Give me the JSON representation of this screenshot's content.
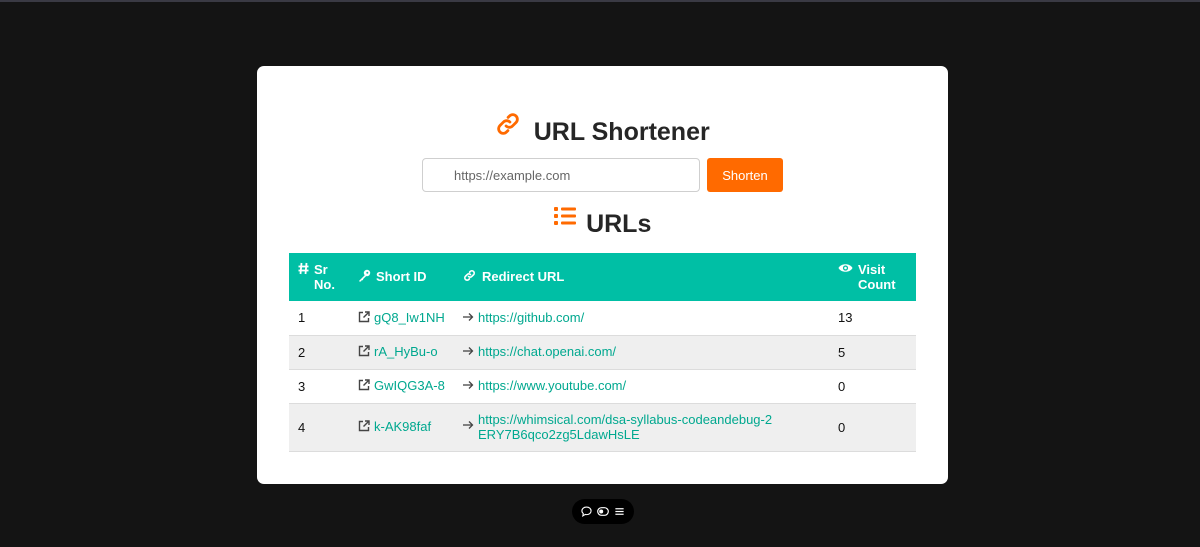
{
  "header": {
    "title": "URL Shortener",
    "title_icon": "link-icon",
    "accent_color": "#ff6a00"
  },
  "form": {
    "url_placeholder": "https://example.com",
    "url_value": "",
    "submit_label": "Shorten"
  },
  "list": {
    "title": "URLs",
    "title_icon": "list-icon",
    "header_color": "#00bfa5",
    "columns": [
      {
        "label": "Sr No.",
        "icon": "hash-icon"
      },
      {
        "label": "Short ID",
        "icon": "key-icon"
      },
      {
        "label": "Redirect URL",
        "icon": "link-icon"
      },
      {
        "label": "Visit Count",
        "icon": "eye-icon"
      }
    ],
    "rows": [
      {
        "sr": "1",
        "short_id": "gQ8_Iw1NH",
        "redirect_url": "https://github.com/",
        "visits": "13"
      },
      {
        "sr": "2",
        "short_id": "rA_HyBu-o",
        "redirect_url": "https://chat.openai.com/",
        "visits": "5"
      },
      {
        "sr": "3",
        "short_id": "GwIQG3A-8",
        "redirect_url": "https://www.youtube.com/",
        "visits": "0"
      },
      {
        "sr": "4",
        "short_id": "k-AK98faf",
        "redirect_url": "https://whimsical.com/dsa-syllabus-codeandebug-2ERY7B6qco2zg5LdawHsLE",
        "visits": "0"
      }
    ]
  },
  "dock": {
    "icons": [
      "chat-icon",
      "toggle-icon",
      "menu-icon"
    ]
  }
}
